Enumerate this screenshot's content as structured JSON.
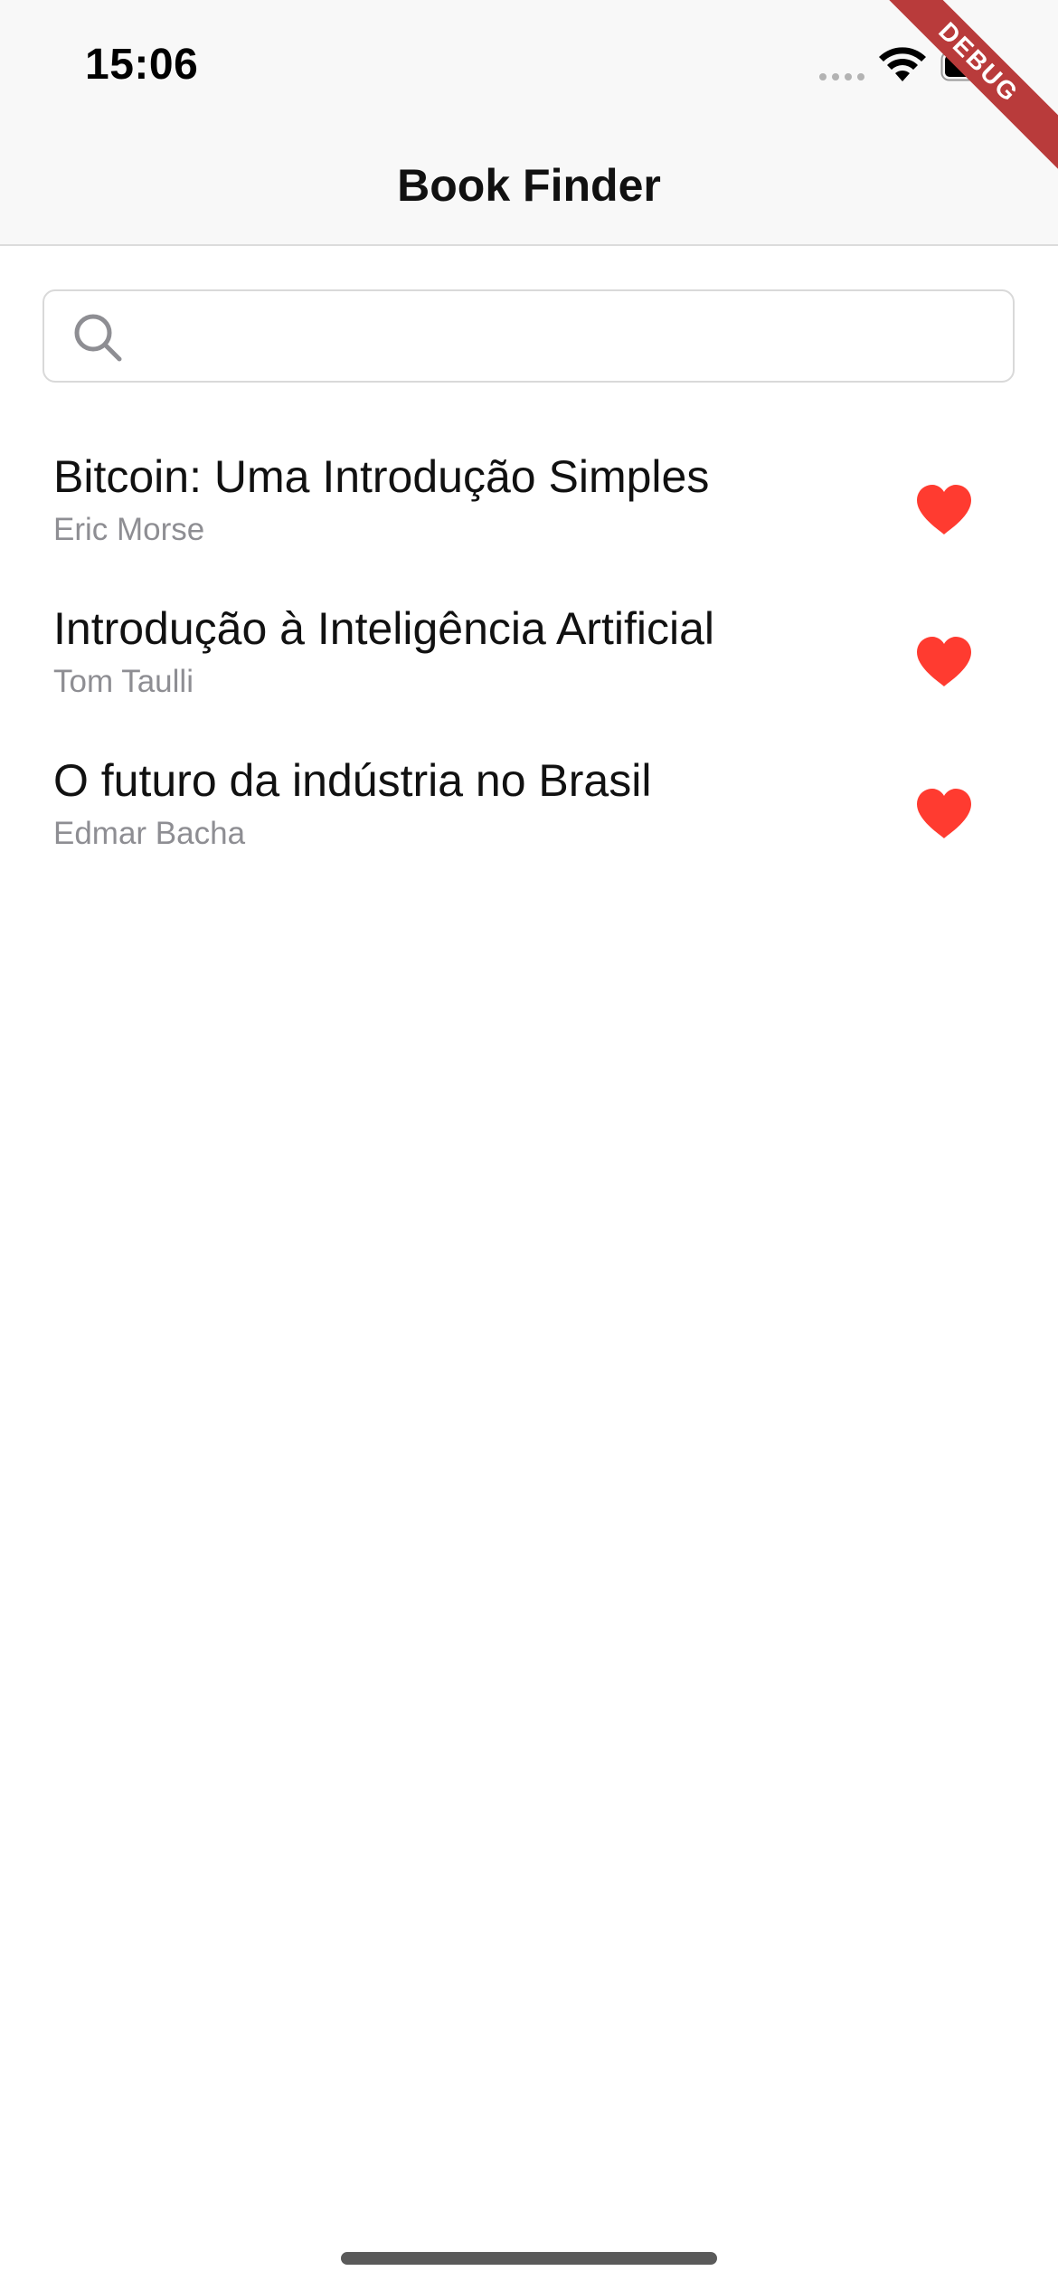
{
  "status_bar": {
    "time": "15:06"
  },
  "debug_banner": {
    "label": "DEBUG"
  },
  "nav": {
    "title": "Book Finder"
  },
  "search": {
    "value": "",
    "placeholder": "",
    "icon": "search-icon"
  },
  "books": [
    {
      "title": "Bitcoin: Uma Introdução Simples",
      "author": "Eric Morse",
      "favorite": true
    },
    {
      "title": "Introdução à Inteligência Artificial",
      "author": "Tom Taulli",
      "favorite": true
    },
    {
      "title": "O futuro da indústria no Brasil",
      "author": "Edmar Bacha",
      "favorite": true
    }
  ],
  "colors": {
    "favorite": "#ff3b30",
    "secondary_text": "#8e8e93",
    "debug_ribbon": "#b93b3b"
  }
}
